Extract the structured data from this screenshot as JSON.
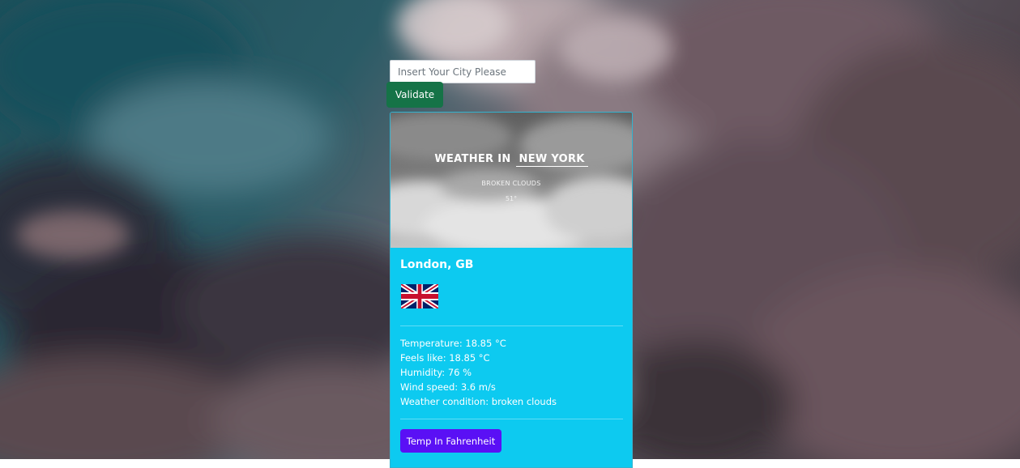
{
  "search": {
    "placeholder": "Insert Your City Please",
    "value": ""
  },
  "validate_label": "Validate",
  "banner": {
    "prefix": "WEATHER IN",
    "city": "NEW YORK",
    "condition": "BROKEN CLOUDS",
    "temperature": "51°"
  },
  "card": {
    "location": "London, GB",
    "flag_icon": "uk-flag-icon",
    "details": {
      "temperature": "Temperature: 18.85 °C",
      "feels_like": "Feels like: 18.85 °C",
      "humidity": "Humidity: 76 %",
      "wind_speed": "Wind speed: 3.6 m/s",
      "condition": "Weather condition: broken clouds"
    },
    "fahrenheit_button": "Temp In Fahrenheit"
  },
  "colors": {
    "card_background": "#0dcaf0",
    "validate_button": "#157347",
    "fahrenheit_button": "#5a10f5"
  }
}
